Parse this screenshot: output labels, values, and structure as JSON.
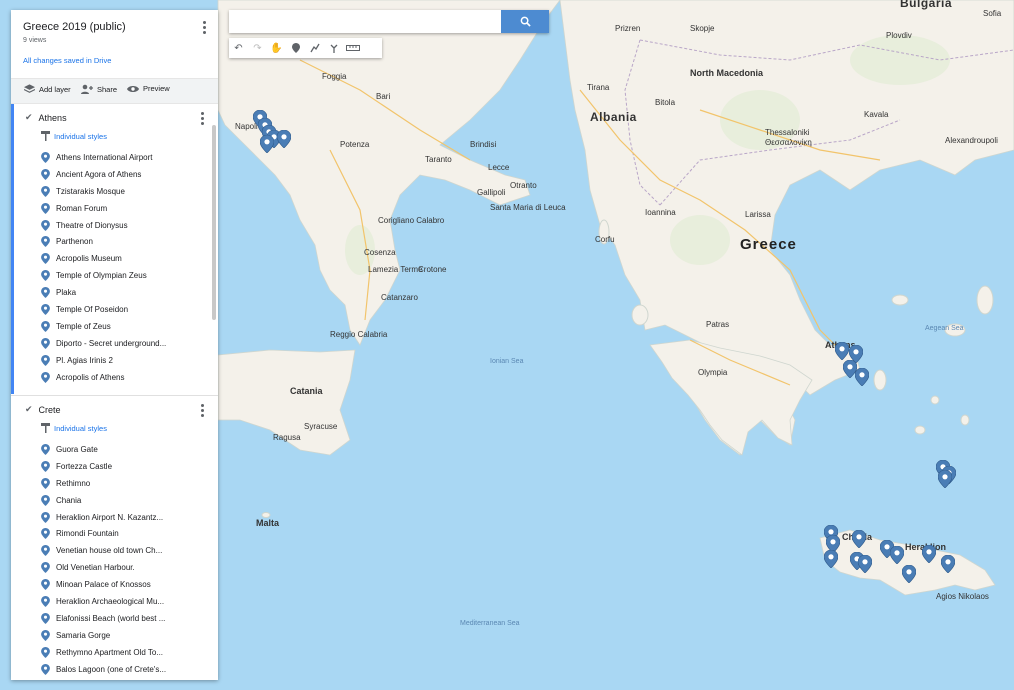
{
  "map_title": "Greece 2019 (public)",
  "views": "9 views",
  "saved_status": "All changes saved in Drive",
  "toolbar": {
    "add_layer": "Add layer",
    "share": "Share",
    "preview": "Preview"
  },
  "search": {
    "value": ""
  },
  "layers": [
    {
      "name": "Athens",
      "style_label": "Individual styles",
      "items": [
        "Athens International Airport",
        "Ancient Agora of Athens",
        "Tzistarakis Mosque",
        "Roman Forum",
        "Theatre of Dionysus",
        "Parthenon",
        "Acropolis Museum",
        "Temple of Olympian Zeus",
        "Plaka",
        "Temple Of Poseidon",
        "Temple of Zeus",
        "Diporto - Secret underground...",
        "Pl. Agias Irinis 2",
        "Acropolis of Athens"
      ]
    },
    {
      "name": "Crete",
      "style_label": "Individual styles",
      "items": [
        "Guora Gate",
        "Fortezza Castle",
        "Rethimno",
        "Chania",
        "Heraklion Airport N. Kazantz...",
        "Rimondi Fountain",
        "Venetian house old town Ch...",
        "Old Venetian Harbour.",
        "Minoan Palace of Knossos",
        "Heraklion Archaeological Mu...",
        "Elafonissi Beach (world best ...",
        "Samaria Gorge",
        "Rethymno Apartment Old To...",
        "Balos Lagoon (one of Crete's..."
      ]
    }
  ],
  "colors": {
    "land": "#f4f1ea",
    "sea": "#a9d7f3",
    "pin": "#4a7db5",
    "accent": "#1a73e8",
    "search_button": "#4d8bd1"
  },
  "icons": {
    "search": "search-icon",
    "undo": "undo-icon",
    "redo": "redo-icon",
    "hand": "hand-icon",
    "marker": "marker-icon",
    "line": "draw-line-icon",
    "route": "directions-icon",
    "ruler": "ruler-icon"
  },
  "map_labels": {
    "countries": [
      "Albania",
      "Greece",
      "North Macedonia",
      "Bulgaria",
      "Malta"
    ],
    "seas": [
      "Ionian Sea",
      "Mediterranean Sea",
      "Aegean Sea"
    ],
    "cities": [
      "Napoli",
      "Foggia",
      "Bari",
      "Potenza",
      "Taranto",
      "Brindisi",
      "Lecce",
      "Gallipoli",
      "Otranto",
      "Santa Maria di Leuca",
      "Corigliano Calabro",
      "Cosenza",
      "Lamezia Terme",
      "Crotone",
      "Catanzaro",
      "Reggio Calabria",
      "Catania",
      "Syracuse",
      "Ragusa",
      "Tirana",
      "Prizren",
      "Skopje",
      "Bitola",
      "Thessaloniki",
      "Θεσσαλονίκη",
      "Ioannina",
      "Larissa",
      "Corfu",
      "Patras",
      "Athens",
      "Olympia",
      "Kavala",
      "Plovdiv",
      "Alexandroupoli",
      "Chania",
      "Heraklion",
      "Agios Nikolaos",
      "Sofia"
    ]
  }
}
